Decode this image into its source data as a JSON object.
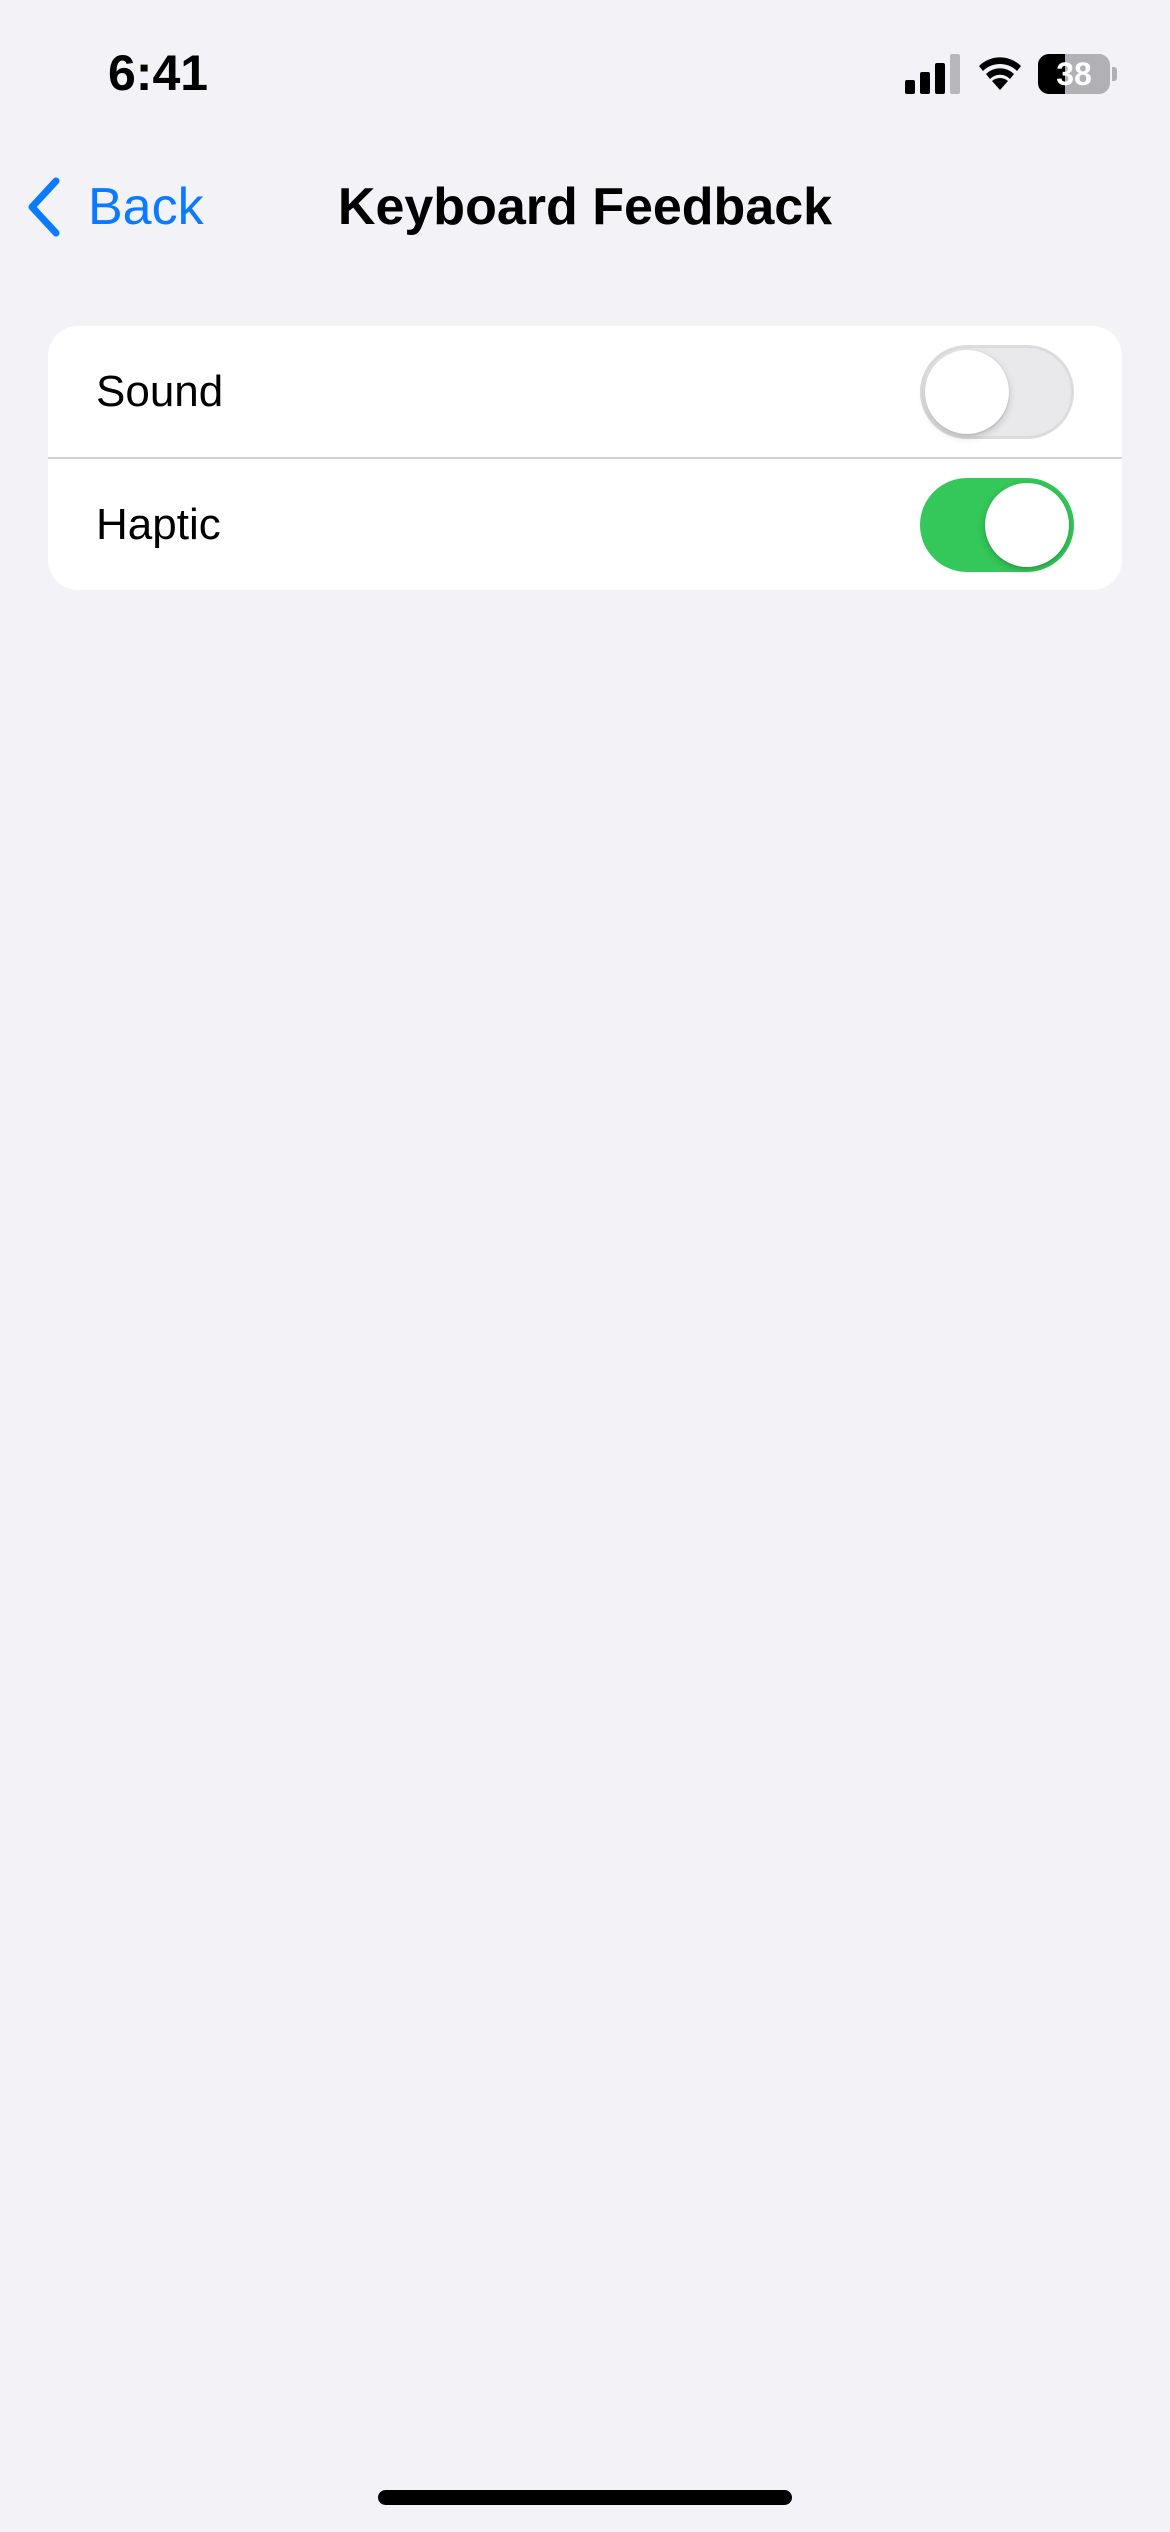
{
  "status_bar": {
    "time": "6:41",
    "signal_icon": "cellular-signal-icon",
    "wifi_icon": "wifi-icon",
    "battery": {
      "level": 38,
      "label": "38"
    }
  },
  "nav": {
    "back_label": "Back",
    "back_icon": "chevron-left-icon",
    "title": "Keyboard Feedback"
  },
  "settings": {
    "rows": [
      {
        "label": "Sound",
        "enabled": false
      },
      {
        "label": "Haptic",
        "enabled": true
      }
    ]
  },
  "colors": {
    "accent": "#0A7AFF",
    "toggle_on": "#34C759",
    "background": "#F2F2F7"
  }
}
